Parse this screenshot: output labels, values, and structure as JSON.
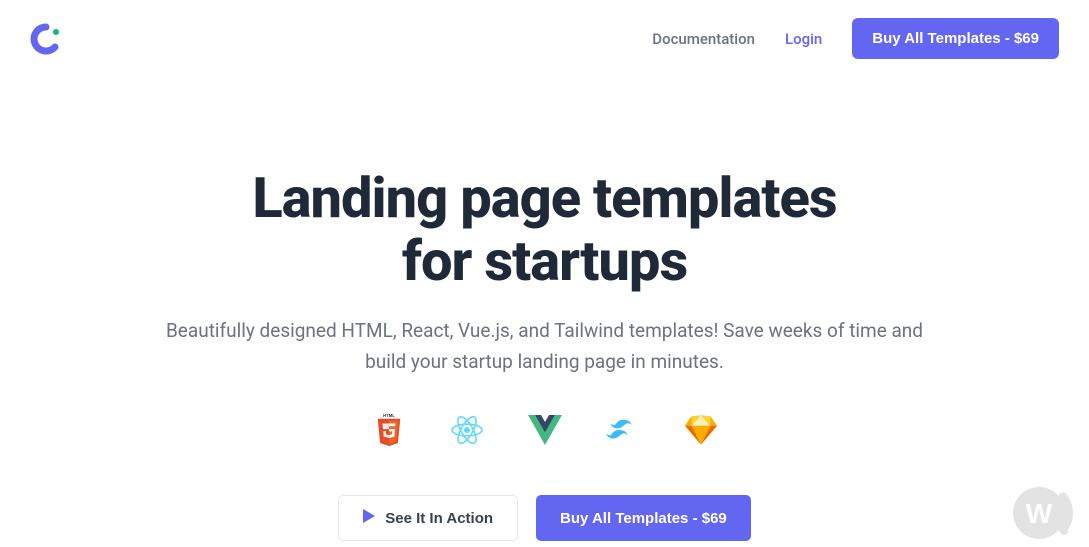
{
  "nav": {
    "documentation": "Documentation",
    "login": "Login",
    "buy_button": "Buy All Templates - $69"
  },
  "hero": {
    "title_line1": "Landing page templates",
    "title_line2": "for startups",
    "subtitle": "Beautifully designed HTML, React, Vue.js, and Tailwind templates! Save weeks of time and build your startup landing page in minutes.",
    "cta_secondary": "See It In Action",
    "cta_primary": "Buy All Templates - $69"
  },
  "tech": {
    "html5": "HTML5",
    "react": "React",
    "vue": "Vue.js",
    "tailwind": "Tailwind",
    "sketch": "Sketch"
  }
}
